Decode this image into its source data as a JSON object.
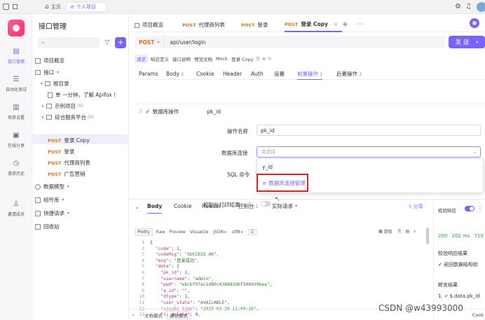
{
  "titlebar": {
    "home_label": "主页",
    "project_tab": "个人项目"
  },
  "rail": [
    {
      "label": "接口管理",
      "icon": "api-icon",
      "active": true
    },
    {
      "label": "自动化测试",
      "icon": "test-icon"
    },
    {
      "label": "项目设置",
      "icon": "settings-icon"
    },
    {
      "label": "在线分享",
      "icon": "share-icon"
    },
    {
      "label": "请求历史",
      "icon": "history-icon"
    },
    {
      "label": "邀请成员",
      "icon": "invite-icon"
    }
  ],
  "sidebar": {
    "title": "接口管理",
    "search_placeholder": "",
    "items": [
      {
        "label": "项目概览"
      },
      {
        "label": "接口"
      },
      {
        "label": "根目录"
      },
      {
        "label": "单 一分钟，了解 Apifox !"
      },
      {
        "label": "示例项目",
        "count": "(5)"
      },
      {
        "label": "综合服务平台",
        "count": "(0)"
      },
      {
        "method": "POST",
        "label": "登录 Copy"
      },
      {
        "method": "POST",
        "label": "登录"
      },
      {
        "method": "POST",
        "label": "代理商列表"
      },
      {
        "method": "POST",
        "label": "广告营销"
      },
      {
        "label": "数据模型"
      },
      {
        "label": "组件库"
      },
      {
        "label": "快捷请求"
      },
      {
        "label": "回收站"
      }
    ]
  },
  "tabs": [
    {
      "label": "项目概览"
    },
    {
      "method": "POST",
      "label": "代理商列表"
    },
    {
      "method": "POST",
      "label": "登录"
    },
    {
      "method": "POST",
      "label": "登录 Copy",
      "active": true
    }
  ],
  "request": {
    "method": "POST",
    "url": "api/user/login",
    "send_label": "发 送"
  },
  "subtabs": [
    "请求",
    "响应定义",
    "接口说明",
    "预览文档",
    "Mock",
    "登录 Copy"
  ],
  "paramtabs": [
    {
      "label": "Params"
    },
    {
      "label": "Body",
      "count": "2"
    },
    {
      "label": "Cookie"
    },
    {
      "label": "Header"
    },
    {
      "label": "Auth"
    },
    {
      "label": "设置"
    },
    {
      "label": "前置操作",
      "count": "1",
      "active": true
    },
    {
      "label": "后置操作",
      "count": "2"
    }
  ],
  "preop": {
    "title": "数据库操作",
    "subtitle": "pk_id",
    "name_label": "操作名称",
    "name_value": "pk_id",
    "db_label": "数据库连接",
    "db_placeholder": "请选择",
    "sql_label": "SQL 命令",
    "print_label": "控制台打印结果",
    "dropdown_option": "y_id",
    "dropdown_manage": "数据库连接管理"
  },
  "response": {
    "tabs": [
      {
        "label": "Body",
        "active": true
      },
      {
        "label": "Cookie"
      },
      {
        "label": "Header",
        "count": "7"
      },
      {
        "label": "控制台",
        "count": "1"
      },
      {
        "label": "实际请求"
      }
    ],
    "share": "分享",
    "formats": [
      "Pretty",
      "Raw",
      "Preview",
      "Visualize",
      "JSON",
      "utf8"
    ],
    "tools": [
      "提取"
    ],
    "code_lines": [
      "{",
      "  \"code\": 1,",
      "  \"codeMsg\": \"SUCCESS OK\",",
      "  \"msg\": \"登录成功\",",
      "  \"data\": {",
      "    \"pk_id\": 1,",
      "    \"username\": \"admin\",",
      "    \"pwd\": \"ebcbf97ec1d80c0388d39bf508039baa\",",
      "    \"a_id\": \"\",",
      "    \"dtype\": 1,",
      "    \"user_state\": \"AVAILABLE\",",
      "    \"create_time\": \"2019-03-20 11:00:26\",",
      "    \"is_delete\": 0,"
    ]
  },
  "rightpanel": {
    "validate_label": "校验响应",
    "status": "200",
    "time": "202 ms",
    "size": "710",
    "validate_result": "校验响应结果",
    "return_struct": "返回数据结构校",
    "assert_result": "断言结果",
    "assert_item": "$.data.pk_id"
  },
  "bottombar": {
    "doc_mode": "文档模式",
    "debug_mode": "调试模式",
    "cookie": "Cook"
  },
  "watermark": "CSDN @w43993000"
}
